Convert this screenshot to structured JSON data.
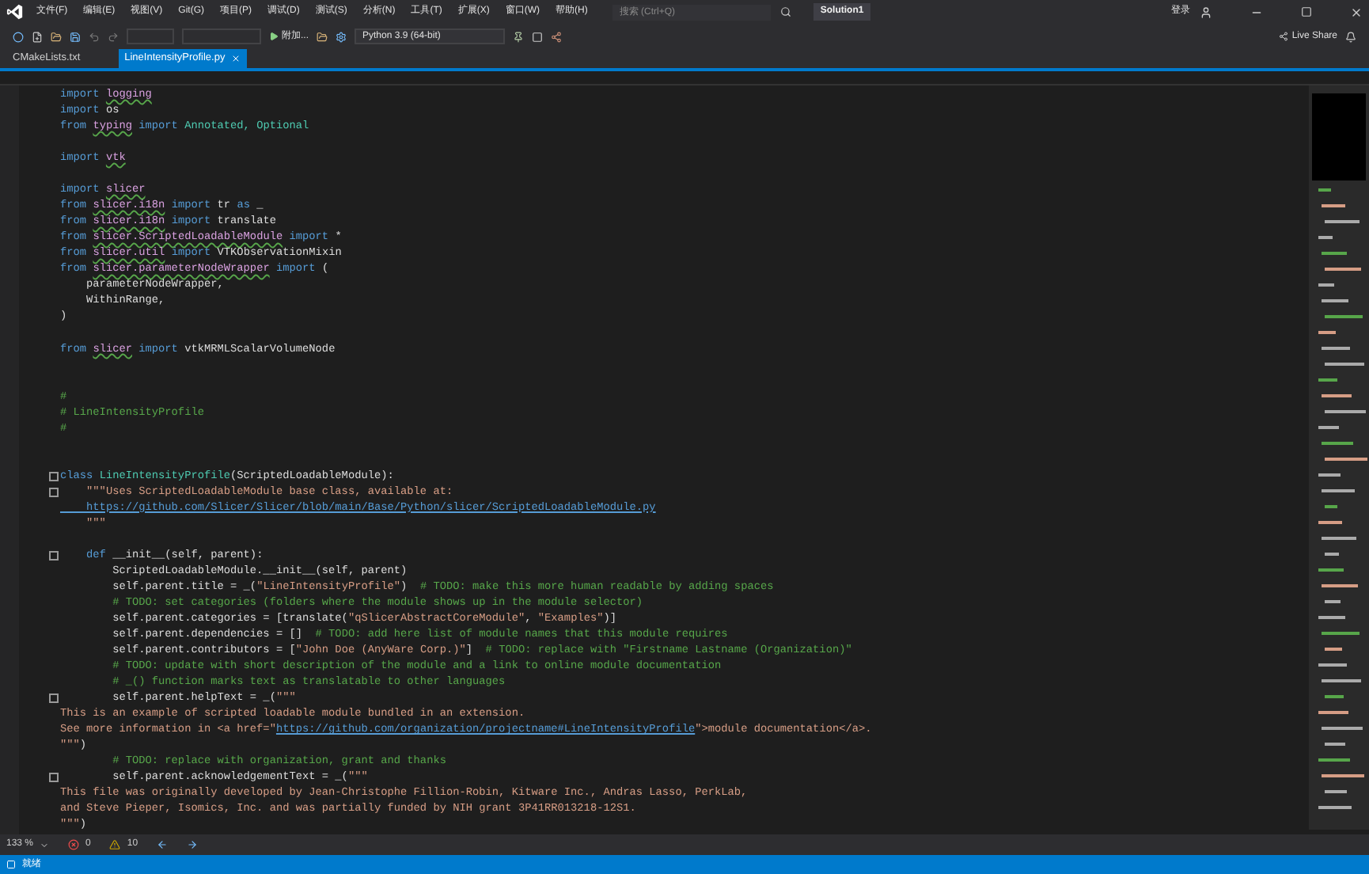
{
  "menu": [
    "文件(F)",
    "编辑(E)",
    "视图(V)",
    "Git(G)",
    "项目(P)",
    "调试(D)",
    "测试(S)",
    "分析(N)",
    "工具(T)",
    "扩展(X)",
    "窗口(W)",
    "帮助(H)"
  ],
  "search": {
    "placeholder": "搜索 (Ctrl+Q)"
  },
  "solution": "Solution1",
  "sign_in": "登录",
  "toolbar": {
    "attach": "附加...",
    "environment": "Python 3.9 (64-bit)",
    "live_share": "Live Share"
  },
  "tabs": [
    {
      "label": "CMakeLists.txt",
      "selected": false
    },
    {
      "label": "LineIntensityProfile.py",
      "selected": true
    }
  ],
  "code": [
    {
      "fold": false,
      "segments": [
        {
          "kind": "keyword",
          "text": "import "
        },
        {
          "kind": "module",
          "text": "logging"
        }
      ]
    },
    {
      "fold": false,
      "segments": [
        {
          "kind": "keyword",
          "text": "import "
        },
        {
          "kind": "plain",
          "text": "os"
        }
      ]
    },
    {
      "fold": false,
      "segments": [
        {
          "kind": "keyword",
          "text": "from "
        },
        {
          "kind": "module",
          "text": "typing"
        },
        {
          "kind": "keyword",
          "text": " import "
        },
        {
          "kind": "class",
          "text": "Annotated, Optional"
        }
      ]
    },
    {
      "fold": false
    },
    {
      "fold": false,
      "segments": [
        {
          "kind": "keyword",
          "text": "import "
        },
        {
          "kind": "module",
          "text": "vtk"
        }
      ]
    },
    {
      "fold": false
    },
    {
      "fold": false,
      "segments": [
        {
          "kind": "keyword",
          "text": "import "
        },
        {
          "kind": "module",
          "text": "slicer"
        }
      ]
    },
    {
      "fold": false,
      "segments": [
        {
          "kind": "keyword",
          "text": "from "
        },
        {
          "kind": "module",
          "text": "slicer.i18n"
        },
        {
          "kind": "keyword",
          "text": " import "
        },
        {
          "kind": "plain",
          "text": "tr "
        },
        {
          "kind": "keyword",
          "text": "as "
        },
        {
          "kind": "plain",
          "text": "_"
        }
      ]
    },
    {
      "fold": false,
      "segments": [
        {
          "kind": "keyword",
          "text": "from "
        },
        {
          "kind": "module",
          "text": "slicer.i18n"
        },
        {
          "kind": "keyword",
          "text": " import "
        },
        {
          "kind": "plain",
          "text": "translate"
        }
      ]
    },
    {
      "fold": false,
      "segments": [
        {
          "kind": "keyword",
          "text": "from "
        },
        {
          "kind": "module",
          "text": "slicer.ScriptedLoadableModule"
        },
        {
          "kind": "keyword",
          "text": " import "
        },
        {
          "kind": "plain",
          "text": "*"
        }
      ]
    },
    {
      "fold": false,
      "segments": [
        {
          "kind": "keyword",
          "text": "from "
        },
        {
          "kind": "module",
          "text": "slicer.util"
        },
        {
          "kind": "keyword",
          "text": " import "
        },
        {
          "kind": "plain",
          "text": "VTKObservationMixin"
        }
      ]
    },
    {
      "fold": false,
      "segments": [
        {
          "kind": "keyword",
          "text": "from "
        },
        {
          "kind": "module",
          "text": "slicer.parameterNodeWrapper"
        },
        {
          "kind": "keyword",
          "text": " import "
        },
        {
          "kind": "plain",
          "text": "("
        }
      ]
    },
    {
      "fold": false,
      "segments": [
        {
          "kind": "plain",
          "text": "    parameterNodeWrapper,"
        }
      ]
    },
    {
      "fold": false,
      "segments": [
        {
          "kind": "plain",
          "text": "    WithinRange,"
        }
      ]
    },
    {
      "fold": false,
      "segments": [
        {
          "kind": "plain",
          "text": ")"
        }
      ]
    },
    {
      "fold": false
    },
    {
      "fold": false,
      "segments": [
        {
          "kind": "keyword",
          "text": "from "
        },
        {
          "kind": "module",
          "text": "slicer"
        },
        {
          "kind": "keyword",
          "text": " import "
        },
        {
          "kind": "plain",
          "text": "vtkMRMLScalarVolumeNode"
        }
      ]
    },
    {
      "fold": false
    },
    {
      "fold": false
    },
    {
      "fold": false,
      "segments": [
        {
          "kind": "comment",
          "text": "#"
        }
      ]
    },
    {
      "fold": false,
      "segments": [
        {
          "kind": "comment",
          "text": "# LineIntensityProfile"
        }
      ]
    },
    {
      "fold": false,
      "segments": [
        {
          "kind": "comment",
          "text": "#"
        }
      ]
    },
    {
      "fold": false
    },
    {
      "fold": false
    },
    {
      "fold": true,
      "segments": [
        {
          "kind": "keyword",
          "text": "class "
        },
        {
          "kind": "class",
          "text": "LineIntensityProfile"
        },
        {
          "kind": "plain",
          "text": "(ScriptedLoadableModule):"
        }
      ]
    },
    {
      "fold": true,
      "segments": [
        {
          "kind": "string",
          "text": "    \"\"\"Uses ScriptedLoadableModule base class, available at:"
        }
      ]
    },
    {
      "fold": false,
      "segments": [
        {
          "kind": "link",
          "text": "    https://github.com/Slicer/Slicer/blob/main/Base/Python/slicer/ScriptedLoadableModule.py"
        }
      ]
    },
    {
      "fold": false,
      "segments": [
        {
          "kind": "string",
          "text": "    \"\"\""
        }
      ]
    },
    {
      "fold": false
    },
    {
      "fold": true,
      "segments": [
        {
          "kind": "keyword",
          "text": "    def "
        },
        {
          "kind": "plain",
          "text": "__init__(self, parent):"
        }
      ]
    },
    {
      "fold": false,
      "segments": [
        {
          "kind": "plain",
          "text": "        ScriptedLoadableModule.__init__(self, parent)"
        }
      ]
    },
    {
      "fold": false,
      "segments": [
        {
          "kind": "plain",
          "text": "        self.parent.title = _("
        },
        {
          "kind": "string",
          "text": "\"LineIntensityProfile\""
        },
        {
          "kind": "plain",
          "text": ")  "
        },
        {
          "kind": "comment",
          "text": "# TODO: make this more human readable by adding spaces"
        }
      ]
    },
    {
      "fold": false,
      "segments": [
        {
          "kind": "comment",
          "text": "        # TODO: set categories (folders where the module shows up in the module selector)"
        }
      ]
    },
    {
      "fold": false,
      "segments": [
        {
          "kind": "plain",
          "text": "        self.parent.categories = [translate("
        },
        {
          "kind": "string",
          "text": "\"qSlicerAbstractCoreModule\""
        },
        {
          "kind": "plain",
          "text": ", "
        },
        {
          "kind": "string",
          "text": "\"Examples\""
        },
        {
          "kind": "plain",
          "text": ")]"
        }
      ]
    },
    {
      "fold": false,
      "segments": [
        {
          "kind": "plain",
          "text": "        self.parent.dependencies = []  "
        },
        {
          "kind": "comment",
          "text": "# TODO: add here list of module names that this module requires"
        }
      ]
    },
    {
      "fold": false,
      "segments": [
        {
          "kind": "plain",
          "text": "        self.parent.contributors = ["
        },
        {
          "kind": "string",
          "text": "\"John Doe (AnyWare Corp.)\""
        },
        {
          "kind": "plain",
          "text": "]  "
        },
        {
          "kind": "comment",
          "text": "# TODO: replace with \"Firstname Lastname (Organization)\""
        }
      ]
    },
    {
      "fold": false,
      "segments": [
        {
          "kind": "comment",
          "text": "        # TODO: update with short description of the module and a link to online module documentation"
        }
      ]
    },
    {
      "fold": false,
      "segments": [
        {
          "kind": "comment",
          "text": "        # _() function marks text as translatable to other languages"
        }
      ]
    },
    {
      "fold": true,
      "segments": [
        {
          "kind": "plain",
          "text": "        self.parent.helpText = _("
        },
        {
          "kind": "string",
          "text": "\"\"\""
        }
      ]
    },
    {
      "fold": false,
      "segments": [
        {
          "kind": "string",
          "text": "This is an example of scripted loadable module bundled in an extension."
        }
      ]
    },
    {
      "fold": false,
      "segments": [
        {
          "kind": "string",
          "text": "See more information in <a href=\""
        },
        {
          "kind": "link",
          "text": "https://github.com/organization/projectname#LineIntensityProfile"
        },
        {
          "kind": "string",
          "text": "\">module documentation</a>."
        }
      ]
    },
    {
      "fold": false,
      "segments": [
        {
          "kind": "string",
          "text": "\"\"\""
        },
        {
          "kind": "plain",
          "text": ")"
        }
      ]
    },
    {
      "fold": false,
      "segments": [
        {
          "kind": "comment",
          "text": "        # TODO: replace with organization, grant and thanks"
        }
      ]
    },
    {
      "fold": true,
      "segments": [
        {
          "kind": "plain",
          "text": "        self.parent.acknowledgementText = _("
        },
        {
          "kind": "string",
          "text": "\"\"\""
        }
      ]
    },
    {
      "fold": false,
      "segments": [
        {
          "kind": "string",
          "text": "This file was originally developed by Jean-Christophe Fillion-Robin, Kitware Inc., Andras Lasso, PerkLab,"
        }
      ]
    },
    {
      "fold": false,
      "segments": [
        {
          "kind": "string",
          "text": "and Steve Pieper, Isomics, Inc. and was partially funded by NIH grant 3P41RR013218-12S1."
        }
      ]
    },
    {
      "fold": false,
      "segments": [
        {
          "kind": "string",
          "text": "\"\"\""
        },
        {
          "kind": "plain",
          "text": ")"
        }
      ]
    }
  ],
  "editor_status": {
    "zoom": "133 %",
    "errors": "0",
    "warnings": "10"
  },
  "status_bar": {
    "text": "就绪"
  }
}
